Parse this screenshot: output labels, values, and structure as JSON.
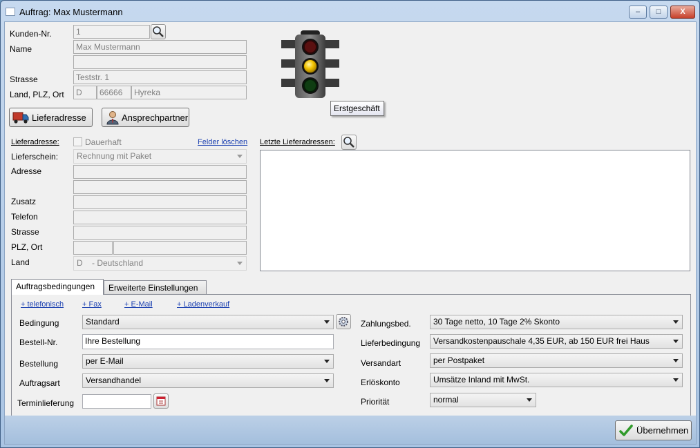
{
  "window": {
    "title": "Auftrag: Max Mustermann",
    "minimize_label": "–",
    "maximize_label": "□",
    "close_label": "X"
  },
  "customer": {
    "kunden_nr_label": "Kunden-Nr.",
    "kunden_nr_value": "1",
    "name_label": "Name",
    "name_value": "Max Mustermann",
    "name2_value": "",
    "strasse_label": "Strasse",
    "strasse_value": "Teststr. 1",
    "land_plz_ort_label": "Land, PLZ, Ort",
    "land_value": "D",
    "plz_value": "66666",
    "ort_value": "Hyreka"
  },
  "traffic_light": {
    "active": "yellow",
    "tooltip": "Erstgeschäft"
  },
  "buttons": {
    "lieferadresse": "Lieferadresse",
    "ansprechpartner": "Ansprechpartner",
    "uebernehmen": "Übernehmen"
  },
  "delivery": {
    "section_label": "Lieferadresse:",
    "dauerhaft_label": "Dauerhaft",
    "felder_loeschen": "Felder löschen",
    "lieferschein_label": "Lieferschein:",
    "lieferschein_value": "Rechnung mit Paket",
    "adresse_label": "Adresse",
    "zusatz_label": "Zusatz",
    "telefon_label": "Telefon",
    "strasse_label": "Strasse",
    "plz_ort_label": "PLZ, Ort",
    "land_label": "Land",
    "land_value": "D    - Deutschland",
    "letzte_label": "Letzte Lieferadressen:"
  },
  "tabs": [
    {
      "label": "Auftragsbedingungen",
      "active": true
    },
    {
      "label": "Erweiterte Einstellungen",
      "active": false
    }
  ],
  "quick_links": [
    "+ telefonisch",
    "+ Fax",
    "+ E-Mail",
    "+ Ladenverkauf"
  ],
  "conditions": {
    "bedingung_label": "Bedingung",
    "bedingung_value": "Standard",
    "bestell_nr_label": "Bestell-Nr.",
    "bestell_nr_value": "Ihre Bestellung",
    "bestellung_label": "Bestellung",
    "bestellung_value": "per E-Mail",
    "auftragsart_label": "Auftragsart",
    "auftragsart_value": "Versandhandel",
    "terminlieferung_label": "Terminlieferung",
    "terminlieferung_value": "",
    "zahlungsbed_label": "Zahlungsbed.",
    "zahlungsbed_value": "30 Tage netto, 10 Tage 2% Skonto",
    "lieferbedingung_label": "Lieferbedingung",
    "lieferbedingung_value": "Versandkostenpauschale 4,35 EUR, ab 150 EUR frei Haus",
    "versandart_label": "Versandart",
    "versandart_value": "per Postpaket",
    "erloeskonto_label": "Erlöskonto",
    "erloeskonto_value": "Umsätze Inland mit MwSt.",
    "prioritaet_label": "Priorität",
    "prioritaet_value": "normal"
  },
  "colors": {
    "accent_link": "#1a3fb0",
    "traffic_yellow": "#f2c300",
    "traffic_red_off": "#5a1010",
    "traffic_green_off": "#0f3d12"
  }
}
